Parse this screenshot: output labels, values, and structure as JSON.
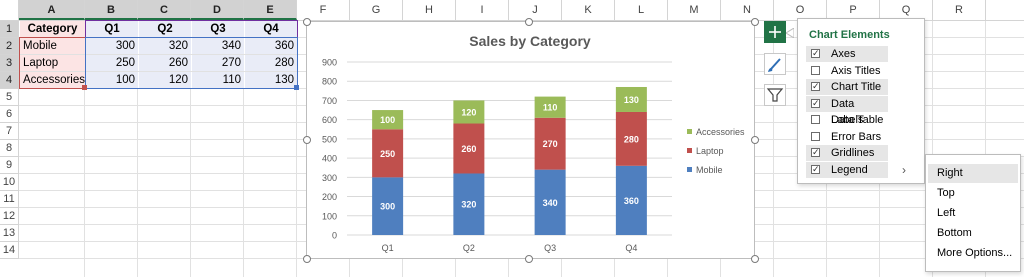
{
  "columns": [
    "A",
    "B",
    "C",
    "D",
    "E",
    "F",
    "G",
    "H",
    "I",
    "J",
    "K",
    "L",
    "M",
    "N",
    "O",
    "P",
    "Q",
    "R"
  ],
  "rows": [
    "1",
    "2",
    "3",
    "4",
    "5",
    "6",
    "7",
    "8",
    "9",
    "10",
    "11",
    "12",
    "13",
    "14"
  ],
  "table": {
    "header": [
      "Category",
      "Q1",
      "Q2",
      "Q3",
      "Q4"
    ],
    "rows": [
      [
        "Mobile",
        "300",
        "320",
        "340",
        "360"
      ],
      [
        "Laptop",
        "250",
        "260",
        "270",
        "280"
      ],
      [
        "Accessories",
        "100",
        "120",
        "110",
        "130"
      ]
    ]
  },
  "chart_data": {
    "type": "bar",
    "stacked": true,
    "title": "Sales by Category",
    "categories": [
      "Q1",
      "Q2",
      "Q3",
      "Q4"
    ],
    "series": [
      {
        "name": "Mobile",
        "values": [
          300,
          320,
          340,
          360
        ],
        "color": "#4f7fbf"
      },
      {
        "name": "Laptop",
        "values": [
          250,
          260,
          270,
          280
        ],
        "color": "#c0504d"
      },
      {
        "name": "Accessories",
        "values": [
          100,
          120,
          110,
          130
        ],
        "color": "#9bbb59"
      }
    ],
    "ylim": [
      0,
      900
    ],
    "yticks": [
      "0",
      "100",
      "200",
      "300",
      "400",
      "500",
      "600",
      "700",
      "800",
      "900"
    ],
    "legend_position": "right",
    "gridlines": true,
    "data_labels": true
  },
  "side_buttons": {
    "elements": "chart-elements-plus-icon",
    "styles": "chart-styles-brush-icon",
    "filters": "chart-filters-funnel-icon"
  },
  "panel": {
    "title": "Chart Elements",
    "items": [
      {
        "label": "Axes",
        "checked": true
      },
      {
        "label": "Axis Titles",
        "checked": false
      },
      {
        "label": "Chart Title",
        "checked": true
      },
      {
        "label": "Data Labels",
        "checked": true
      },
      {
        "label": "Data Table",
        "checked": false
      },
      {
        "label": "Error Bars",
        "checked": false
      },
      {
        "label": "Gridlines",
        "checked": true
      },
      {
        "label": "Legend",
        "checked": true
      }
    ],
    "arrow": "›"
  },
  "submenu": {
    "items": [
      "Right",
      "Top",
      "Left",
      "Bottom",
      "More Options..."
    ]
  },
  "colors": {
    "accent": "#217346",
    "category_fill": "#fce4e4",
    "value_fill": "#e9ecf7"
  }
}
